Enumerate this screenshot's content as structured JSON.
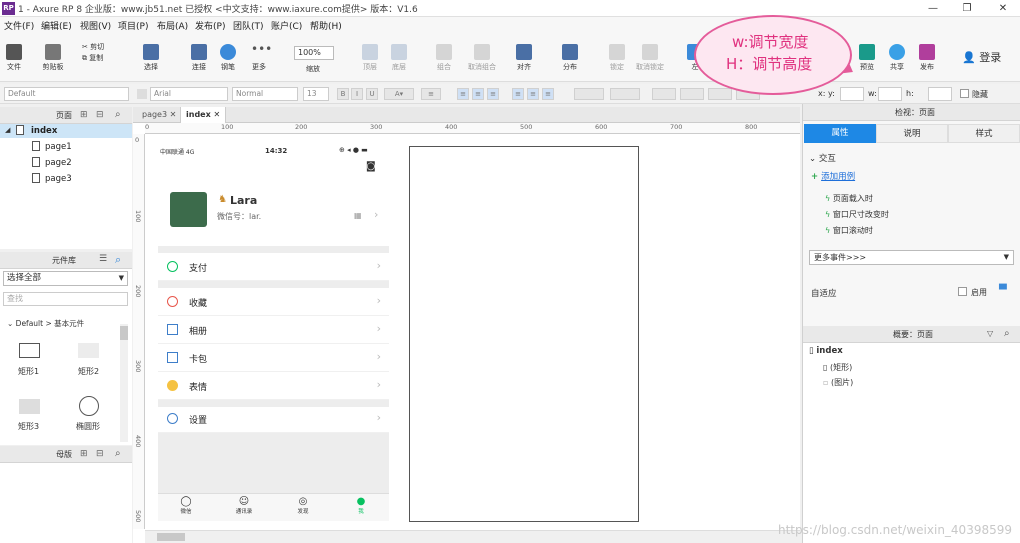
{
  "titlebar": {
    "logo": "RP",
    "title": "1 - Axure RP 8 企业版：www.jb51.net 已授权      <中文支持：www.iaxure.com提供> 版本：V1.6"
  },
  "menu": [
    "文件(F)",
    "编辑(E)",
    "视图(V)",
    "项目(P)",
    "布局(A)",
    "发布(P)",
    "团队(T)",
    "账户(C)",
    "帮助(H)"
  ],
  "toolbar": {
    "file": "文件",
    "clipboard": "剪贴板",
    "cut_label": "剪切",
    "copy_label": "复制",
    "select": "选择",
    "connect": "连接",
    "pen": "钢笔",
    "more": "更多",
    "zoom": "100%",
    "zoom_label": "缩放",
    "top": "顶层",
    "bottom": "底层",
    "group": "组合",
    "ungroup": "取消组合",
    "align": "对齐",
    "distribute": "分布",
    "lock": "锁定",
    "unlock": "取消锁定",
    "left": "左",
    "preview": "预览",
    "share": "共享",
    "publish": "发布",
    "login": "登录"
  },
  "formatbar": {
    "style": "Default",
    "font": "Arial",
    "weight": "Normal",
    "size": "13",
    "x_label": "x:",
    "y_label": "y:",
    "w_label": "w:",
    "h_label": "h:",
    "hidden_label": "隐藏"
  },
  "pages_panel": {
    "title": "页面",
    "items": [
      {
        "label": "index",
        "level": 0
      },
      {
        "label": "page1",
        "level": 1
      },
      {
        "label": "page2",
        "level": 1
      },
      {
        "label": "page3",
        "level": 1
      }
    ]
  },
  "library_panel": {
    "title": "元件库",
    "select": "选择全部",
    "search_placeholder": "查找",
    "group": "Default > 基本元件",
    "widgets": [
      "矩形1",
      "矩形2",
      "矩形3",
      "椭圆形"
    ]
  },
  "masters_panel": {
    "title": "母版"
  },
  "tabs": [
    "page3",
    "index"
  ],
  "ruler": {
    "h": [
      "0",
      "100",
      "200",
      "300",
      "400",
      "500",
      "600",
      "700",
      "800"
    ],
    "v": [
      "0",
      "100",
      "200",
      "300",
      "400",
      "500"
    ]
  },
  "phone": {
    "carrier": "中国联通  4G",
    "time": "14:32",
    "name": "Lara",
    "wechat_id": "微信号：lar.",
    "rows": [
      "支付",
      "收藏",
      "相册",
      "卡包",
      "表情",
      "设置"
    ],
    "tabbar": [
      "微信",
      "通讯录",
      "发现",
      "我"
    ]
  },
  "right_panel": {
    "header": "检视：页面",
    "tabs": [
      "属性",
      "说明",
      "样式"
    ],
    "interaction": "交互",
    "add_case": "添加用例",
    "events": [
      "页面载入时",
      "窗口尺寸改变时",
      "窗口滚动时"
    ],
    "more_events": "更多事件>>>",
    "adaptive": "自适应",
    "enable": "启用",
    "outline_header": "概要：页面",
    "outline_items": [
      "index",
      "(矩形)",
      "(图片)"
    ]
  },
  "annotation": {
    "line1": "w:调节宽度",
    "line2": "H：调节高度"
  },
  "watermark": "https://blog.csdn.net/weixin_40398599"
}
